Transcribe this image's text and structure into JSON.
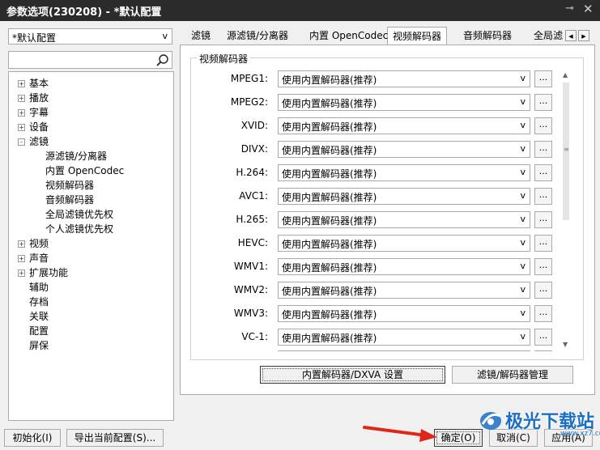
{
  "window": {
    "title": "参数选项(230208) - *默认配置",
    "pin_icon": "pin-icon",
    "close_icon": "close-icon"
  },
  "left": {
    "profile": "*默认配置",
    "search_placeholder": "",
    "tree": [
      {
        "label": "基本",
        "level": 0,
        "expander": "+"
      },
      {
        "label": "播放",
        "level": 0,
        "expander": "+"
      },
      {
        "label": "字幕",
        "level": 0,
        "expander": "+"
      },
      {
        "label": "设备",
        "level": 0,
        "expander": "+"
      },
      {
        "label": "滤镜",
        "level": 0,
        "expander": "-"
      },
      {
        "label": "源滤镜/分离器",
        "level": 1
      },
      {
        "label": "内置 OpenCodec",
        "level": 1
      },
      {
        "label": "视频解码器",
        "level": 1
      },
      {
        "label": "音频解码器",
        "level": 1
      },
      {
        "label": "全局滤镜优先权",
        "level": 1
      },
      {
        "label": "个人滤镜优先权",
        "level": 1
      },
      {
        "label": "视频",
        "level": 0,
        "expander": "+"
      },
      {
        "label": "声音",
        "level": 0,
        "expander": "+"
      },
      {
        "label": "扩展功能",
        "level": 0,
        "expander": "+"
      },
      {
        "label": "辅助",
        "level": 0
      },
      {
        "label": "存档",
        "level": 0
      },
      {
        "label": "关联",
        "level": 0
      },
      {
        "label": "配置",
        "level": 0
      },
      {
        "label": "屏保",
        "level": 0
      }
    ]
  },
  "tabs": [
    "滤镜",
    "源滤镜/分离器",
    "内置 OpenCodec",
    "视频解码器",
    "音频解码器",
    "全局滤"
  ],
  "active_tab": "视频解码器",
  "group_title": "视频解码器",
  "decoders": [
    {
      "label": "MPEG1:",
      "value": "使用内置解码器(推荐)"
    },
    {
      "label": "MPEG2:",
      "value": "使用内置解码器(推荐)"
    },
    {
      "label": "XVID:",
      "value": "使用内置解码器(推荐)"
    },
    {
      "label": "DIVX:",
      "value": "使用内置解码器(推荐)"
    },
    {
      "label": "H.264:",
      "value": "使用内置解码器(推荐)"
    },
    {
      "label": "AVC1:",
      "value": "使用内置解码器(推荐)"
    },
    {
      "label": "H.265:",
      "value": "使用内置解码器(推荐)"
    },
    {
      "label": "HEVC:",
      "value": "使用内置解码器(推荐)"
    },
    {
      "label": "WMV1:",
      "value": "使用内置解码器(推荐)"
    },
    {
      "label": "WMV2:",
      "value": "使用内置解码器(推荐)"
    },
    {
      "label": "WMV3:",
      "value": "使用内置解码器(推荐)"
    },
    {
      "label": "VC-1:",
      "value": "使用内置解码器(推荐)"
    }
  ],
  "dots_label": "...",
  "buttons": {
    "dxva": "内置解码器/DXVA 设置",
    "manage": "滤镜/解码器管理",
    "init": "初始化(I)",
    "export": "导出当前配置(S)...",
    "ok": "确定(O)",
    "cancel": "取消(C)",
    "apply": "应用(A)"
  },
  "watermark": {
    "text": "极光下载站",
    "url": "www.xz7.com"
  },
  "colors": {
    "titlebar": "#2b2b2b",
    "arrow": "#e0261b",
    "watermark": "#1a6fc4"
  }
}
